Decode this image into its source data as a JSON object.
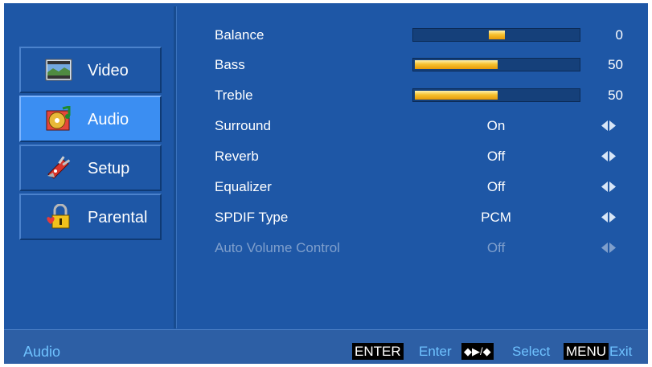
{
  "sidebar": {
    "items": [
      {
        "label": "Video",
        "icon": "video-icon"
      },
      {
        "label": "Audio",
        "icon": "audio-icon",
        "selected": true
      },
      {
        "label": "Setup",
        "icon": "tools-icon"
      },
      {
        "label": "Parental",
        "icon": "lock-icon"
      }
    ]
  },
  "menu": {
    "rows": [
      {
        "label": "Balance",
        "value": "0",
        "level": 0
      },
      {
        "label": "Bass",
        "value": "50",
        "level": 50
      },
      {
        "label": "Treble",
        "value": "50",
        "level": 50
      },
      {
        "label": "Surround",
        "value": "On"
      },
      {
        "label": "Reverb",
        "value": "Off"
      },
      {
        "label": "Equalizer",
        "value": "Off"
      },
      {
        "label": "SPDIF Type",
        "value": "PCM"
      },
      {
        "label": "Auto Volume Control",
        "value": "Off",
        "disabled": true
      }
    ]
  },
  "footer": {
    "title": "Audio",
    "enter_key": "ENTER",
    "enter_hint": "Enter",
    "select_key": "◆▶/◆",
    "select_hint": "Select",
    "menu_key": "MENU",
    "menu_hint": "Exit"
  },
  "colors": {
    "background": "#1e57a6",
    "selected": "#3b8ef2",
    "hint_text": "#6fc2ff",
    "slider_fill": "#f6c230"
  }
}
